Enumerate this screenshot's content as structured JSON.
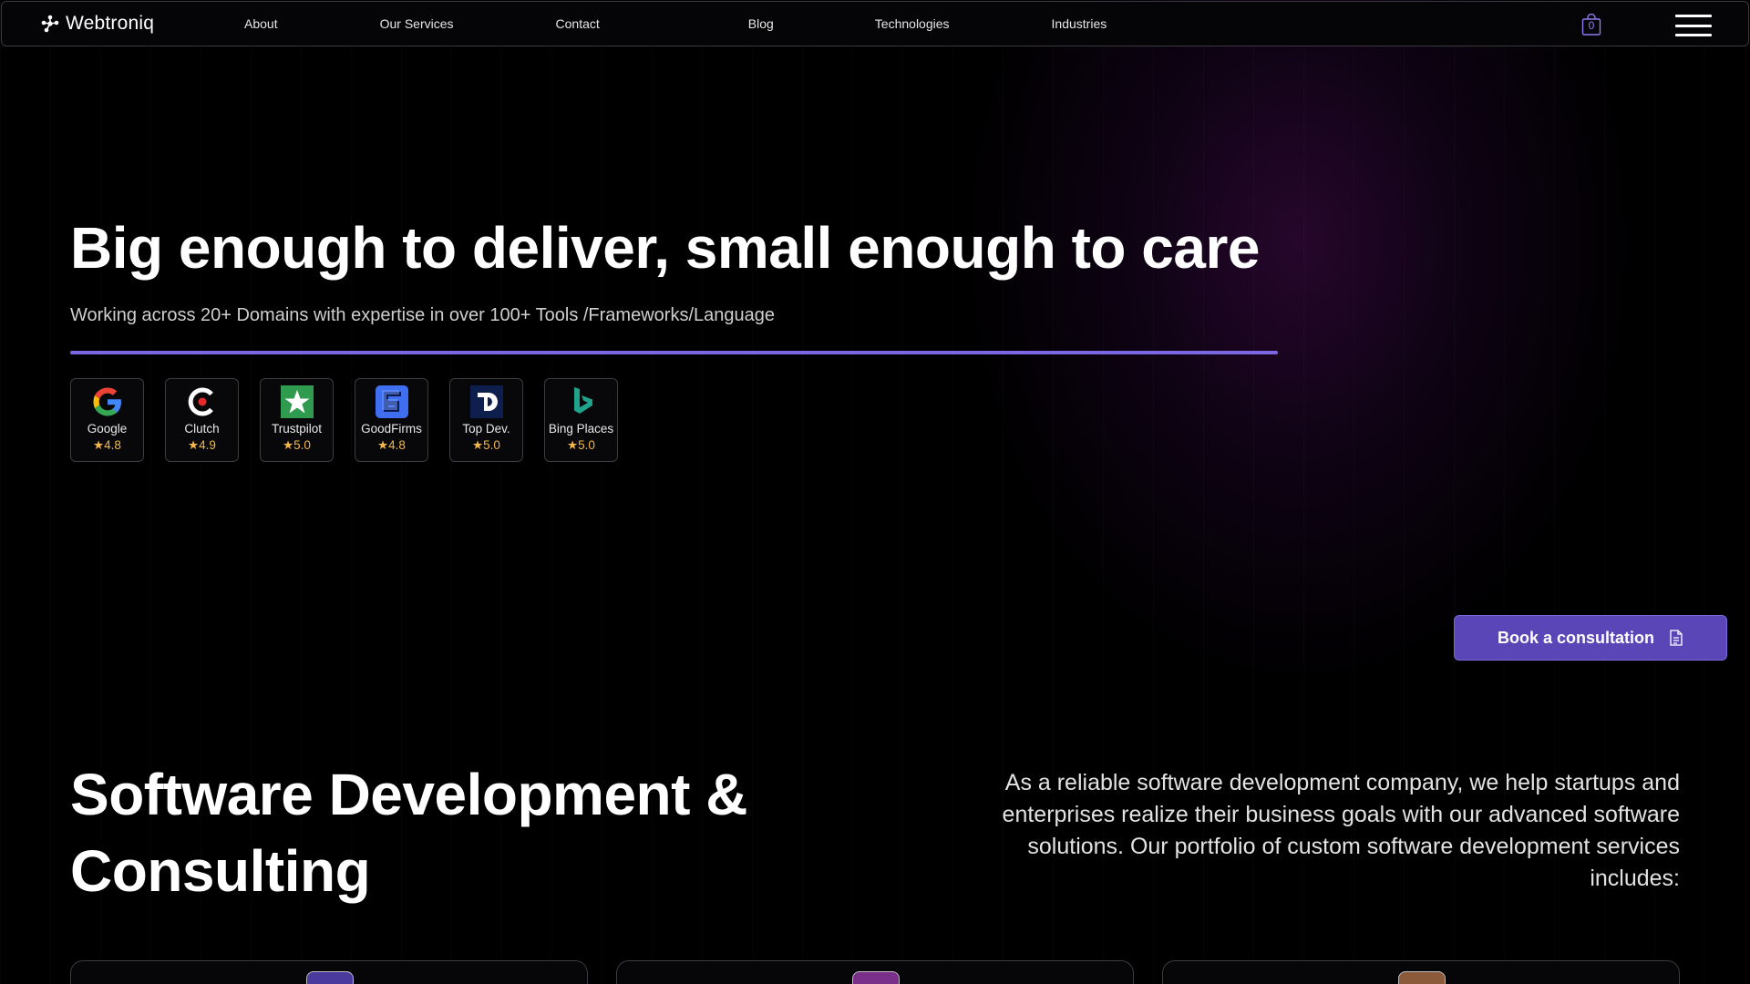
{
  "nav": {
    "brand": "Webtroniq",
    "links": [
      "About",
      "Our Services",
      "Contact",
      "Blog",
      "Technologies",
      "Industries"
    ],
    "cart_count": "0",
    "icons": {
      "brand": "webtroniq-logo-icon",
      "cart": "shopping-bag-icon",
      "menu": "hamburger-menu-icon"
    }
  },
  "hero": {
    "title": "Big enough to deliver, small enough to care",
    "subtitle": "Working across 20+ Domains with expertise in over 100+ Tools /Frameworks/Language",
    "accent_color": "#7b66e3",
    "ratings": [
      {
        "name": "Google",
        "score": "4.8",
        "icon": "google-icon"
      },
      {
        "name": "Clutch",
        "score": "4.9",
        "icon": "clutch-icon"
      },
      {
        "name": "Trustpilot",
        "score": "5.0",
        "icon": "trustpilot-icon"
      },
      {
        "name": "GoodFirms",
        "score": "4.8",
        "icon": "goodfirms-icon"
      },
      {
        "name": "Top Dev.",
        "score": "5.0",
        "icon": "top-developers-icon"
      },
      {
        "name": "Bing Places",
        "score": "5.0",
        "icon": "bing-icon"
      }
    ],
    "star": "★",
    "cta_label": "Book a consultation",
    "cta_icon": "document-icon",
    "cta_color": "#5b46b7"
  },
  "services": {
    "title": "Software Development & Consulting",
    "description": "As a reliable software development company, we help startups and enterprises realize their business goals with our advanced software solutions. Our portfolio of custom software development services includes:",
    "card_icon_colors": [
      "#4a3a9e",
      "#7a2f8a",
      "#8a5a3a"
    ]
  }
}
